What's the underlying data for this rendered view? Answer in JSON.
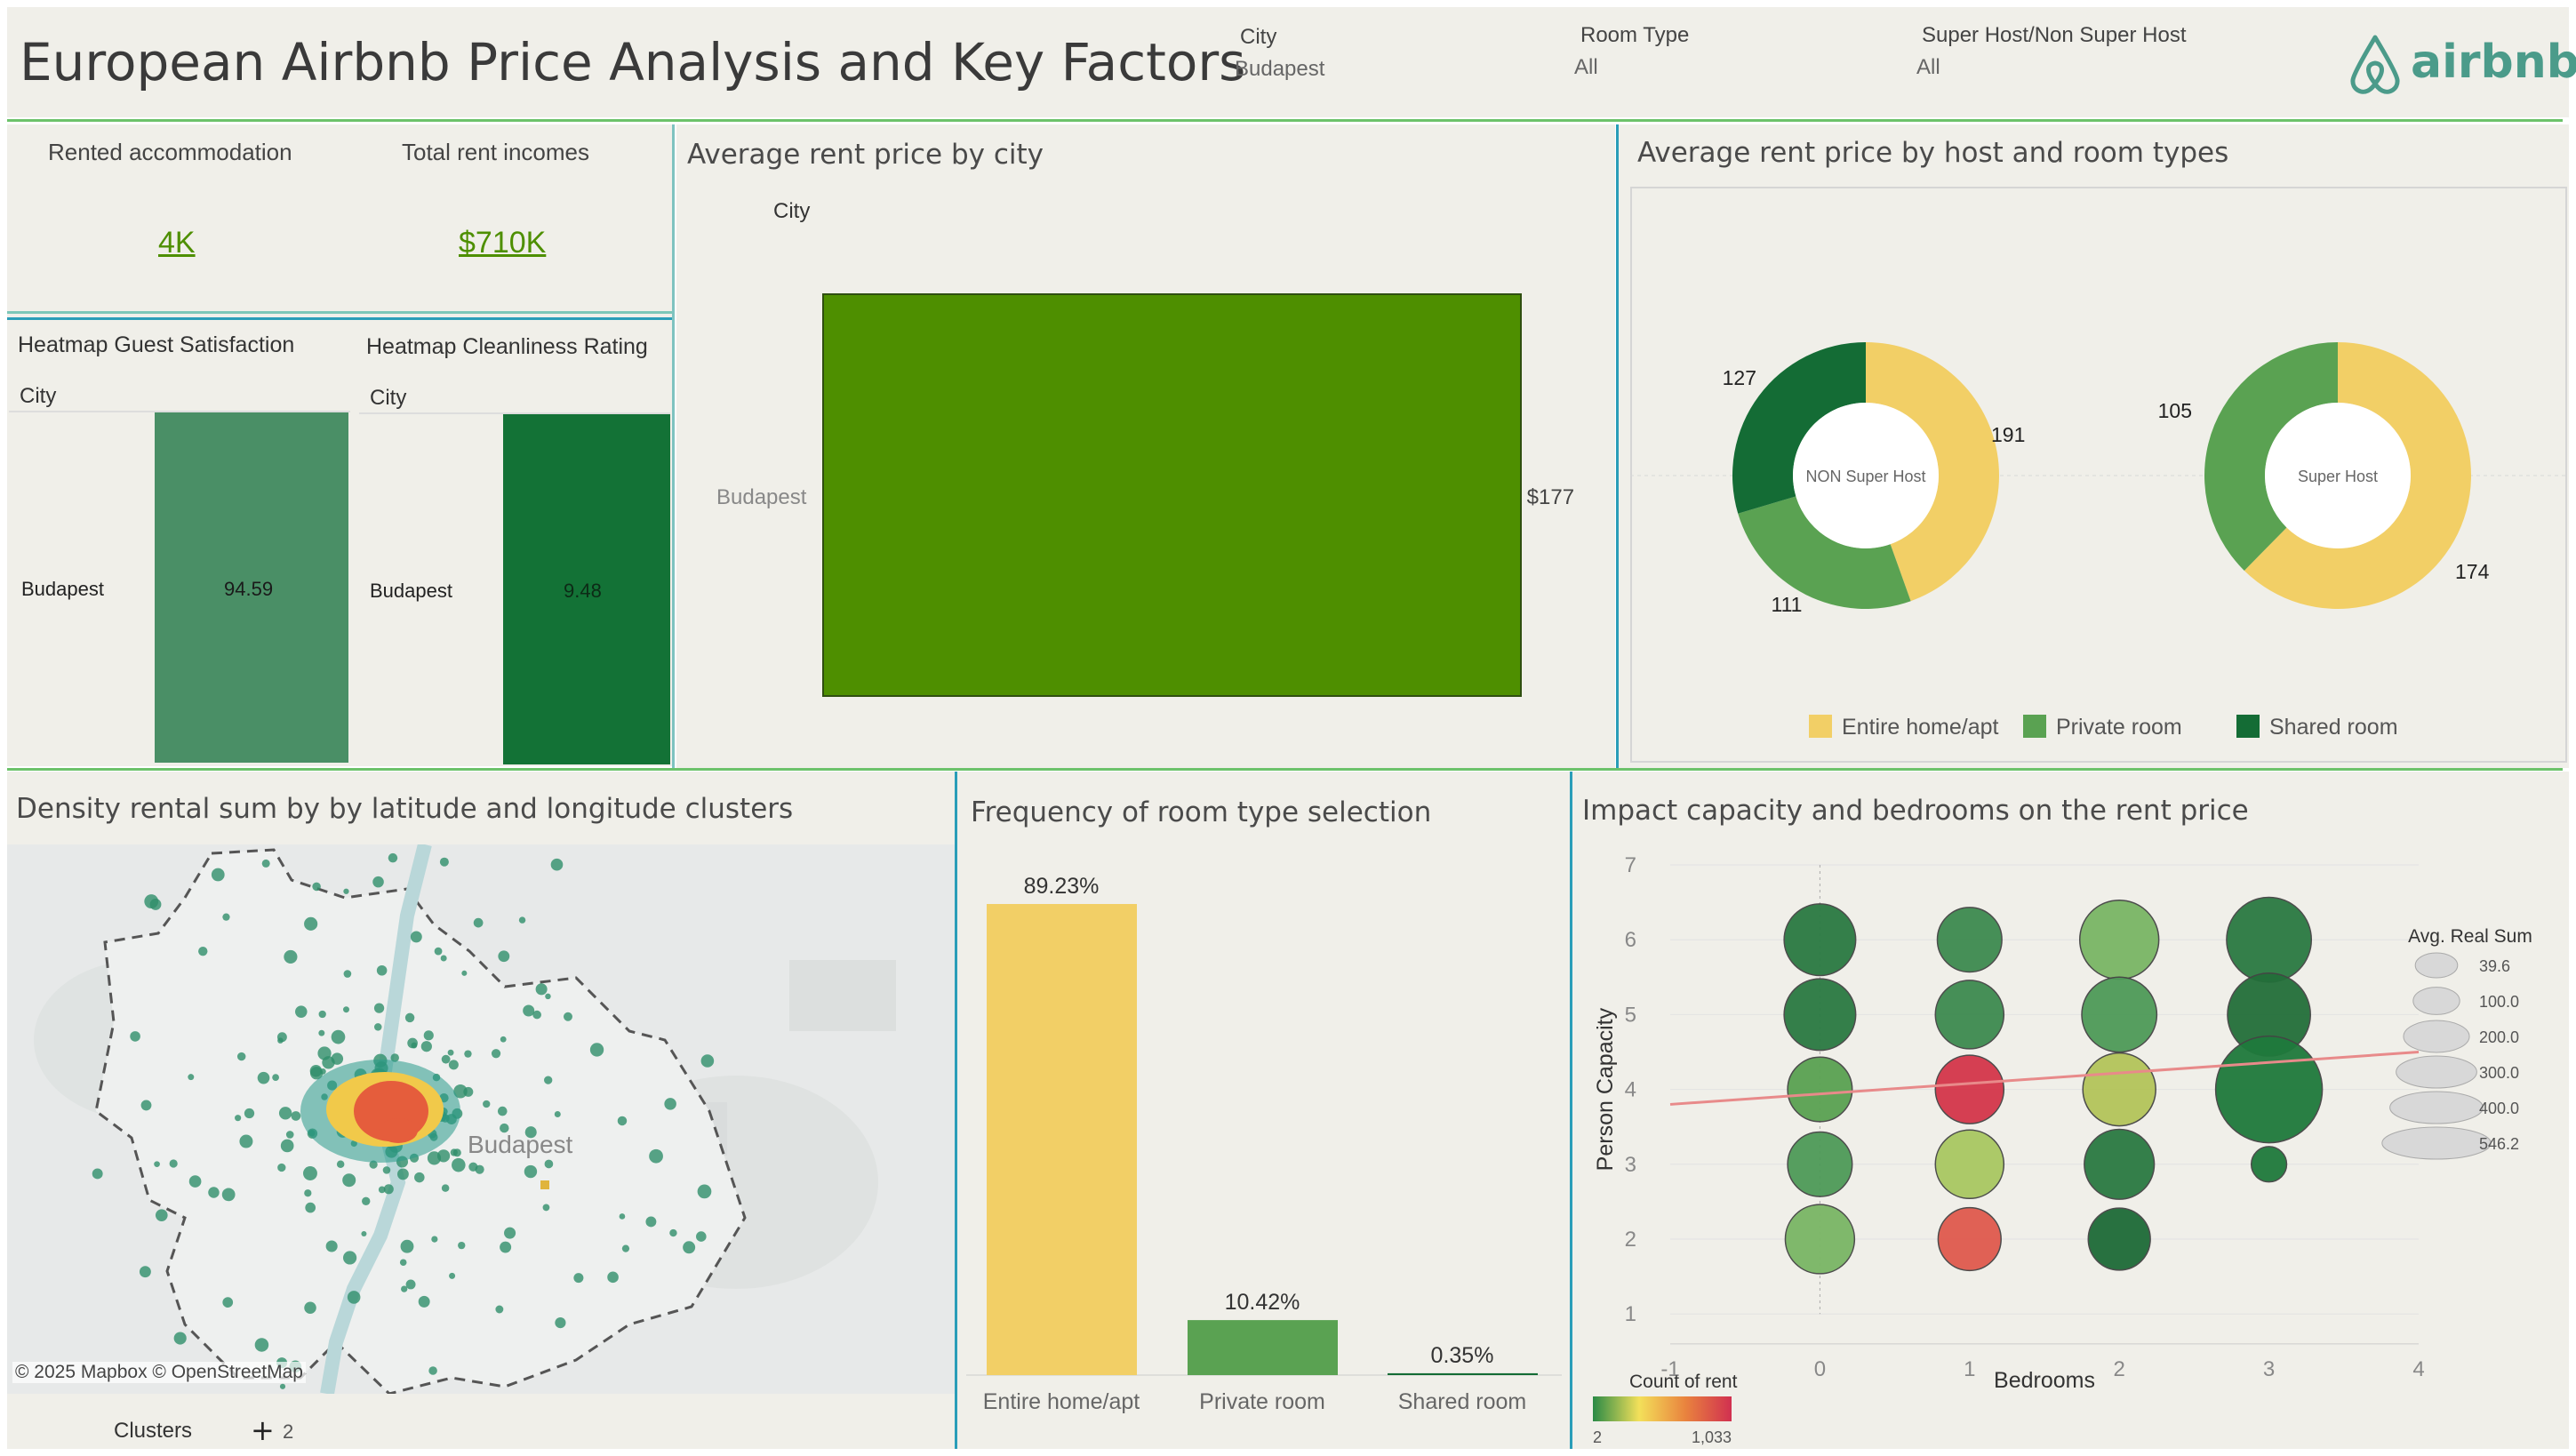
{
  "header": {
    "title": "European Airbnb Price Analysis and Key Factors",
    "filters": [
      {
        "label": "City",
        "value": "Budapest"
      },
      {
        "label": "Room Type",
        "value": "All"
      },
      {
        "label": "Super Host/Non Super Host",
        "value": "All"
      }
    ],
    "logo_text": "airbnb"
  },
  "kpis": {
    "rented_label": "Rented accommodation",
    "rented_value": "4K",
    "income_label": "Total rent incomes",
    "income_value": "$710K"
  },
  "heatmaps": {
    "guest": {
      "title": "Heatmap Guest Satisfaction",
      "col_header": "City",
      "row": "Budapest",
      "value": "94.59"
    },
    "clean": {
      "title": "Heatmap Cleanliness Rating",
      "col_header": "City",
      "row": "Budapest",
      "value": "9.48"
    }
  },
  "avg_city": {
    "title": "Average rent price by city",
    "col_header": "City",
    "chart_data": {
      "type": "bar",
      "orientation": "horizontal",
      "categories": [
        "Budapest"
      ],
      "values": [
        177
      ],
      "labels": [
        "$177"
      ],
      "color": "#4e8f00"
    }
  },
  "host_room": {
    "title": "Average rent price by host and room types",
    "chart_data": {
      "type": "pie",
      "donut": true,
      "categories": [
        "Entire home/apt",
        "Private room",
        "Shared room"
      ],
      "colors": [
        "#f2cf66",
        "#5aa252",
        "#146c35"
      ],
      "charts": [
        {
          "center_label": "NON Super Host",
          "values": [
            191,
            111,
            127
          ]
        },
        {
          "center_label": "Super Host",
          "values": [
            174,
            105,
            0
          ]
        }
      ],
      "legend_position": "bottom"
    }
  },
  "density_map": {
    "title": "Density rental sum by by latitude and longitude clusters",
    "city_label": "Budapest",
    "attribution": "© 2025 Mapbox © OpenStreetMap",
    "clusters_label": "Clusters",
    "clusters_value": "2"
  },
  "room_freq": {
    "title": "Frequency of room type selection",
    "chart_data": {
      "type": "bar",
      "categories": [
        "Entire home/apt",
        "Private room",
        "Shared room"
      ],
      "values": [
        89.23,
        10.42,
        0.35
      ],
      "labels": [
        "89.23%",
        "10.42%",
        "0.35%"
      ],
      "colors": [
        "#f2cf66",
        "#5aa252",
        "#146c35"
      ]
    }
  },
  "capacity": {
    "title": "Impact capacity and bedrooms on the rent price",
    "chart_data": {
      "type": "scatter",
      "xlabel": "Bedrooms",
      "ylabel": "Person Capacity",
      "xlim": [
        -1,
        4
      ],
      "ylim": [
        1,
        7
      ],
      "x_ticks": [
        "-1",
        "0",
        "1",
        "2",
        "3",
        "4"
      ],
      "y_ticks": [
        "1",
        "2",
        "3",
        "4",
        "5",
        "6",
        "7"
      ],
      "points": [
        {
          "x": 0,
          "y": 6,
          "size": 246,
          "color": "#2a7a42"
        },
        {
          "x": 0,
          "y": 5,
          "size": 246,
          "color": "#2a7a42"
        },
        {
          "x": 0,
          "y": 4,
          "size": 200,
          "color": "#5aa252"
        },
        {
          "x": 0,
          "y": 3,
          "size": 200,
          "color": "#4e9a58"
        },
        {
          "x": 0,
          "y": 2,
          "size": 230,
          "color": "#7ab665"
        },
        {
          "x": 1,
          "y": 6,
          "size": 200,
          "color": "#3d8a50"
        },
        {
          "x": 1,
          "y": 5,
          "size": 225,
          "color": "#3d8a50"
        },
        {
          "x": 1,
          "y": 4,
          "size": 225,
          "color": "#d4364a"
        },
        {
          "x": 1,
          "y": 3,
          "size": 225,
          "color": "#a9c862"
        },
        {
          "x": 1,
          "y": 2,
          "size": 190,
          "color": "#e05a4e"
        },
        {
          "x": 2,
          "y": 6,
          "size": 300,
          "color": "#7ab665"
        },
        {
          "x": 2,
          "y": 5,
          "size": 270,
          "color": "#4e9a58"
        },
        {
          "x": 2,
          "y": 4,
          "size": 255,
          "color": "#b3c45a"
        },
        {
          "x": 2,
          "y": 3,
          "size": 235,
          "color": "#2a7a42"
        },
        {
          "x": 2,
          "y": 2,
          "size": 185,
          "color": "#1e6b38"
        },
        {
          "x": 3,
          "y": 6,
          "size": 345,
          "color": "#2a7a42"
        },
        {
          "x": 3,
          "y": 5,
          "size": 330,
          "color": "#236f3a"
        },
        {
          "x": 3,
          "y": 4,
          "size": 546,
          "color": "#1f7a3c"
        },
        {
          "x": 3,
          "y": 3,
          "size": 60,
          "color": "#1f7a3c"
        }
      ],
      "trend_line": {
        "x": [
          -1,
          4
        ],
        "y": [
          3.8,
          4.5
        ],
        "color": "#e88a8a"
      },
      "size_legend": {
        "title": "Avg. Real Sum",
        "values": [
          "39.6",
          "100.0",
          "200.0",
          "300.0",
          "400.0",
          "546.2"
        ]
      },
      "color_legend": {
        "title": "Count of rent",
        "min": "2",
        "max": "1,033",
        "colors": [
          "#2a8a46",
          "#f3e05a",
          "#e9833e",
          "#d13050"
        ]
      }
    }
  }
}
